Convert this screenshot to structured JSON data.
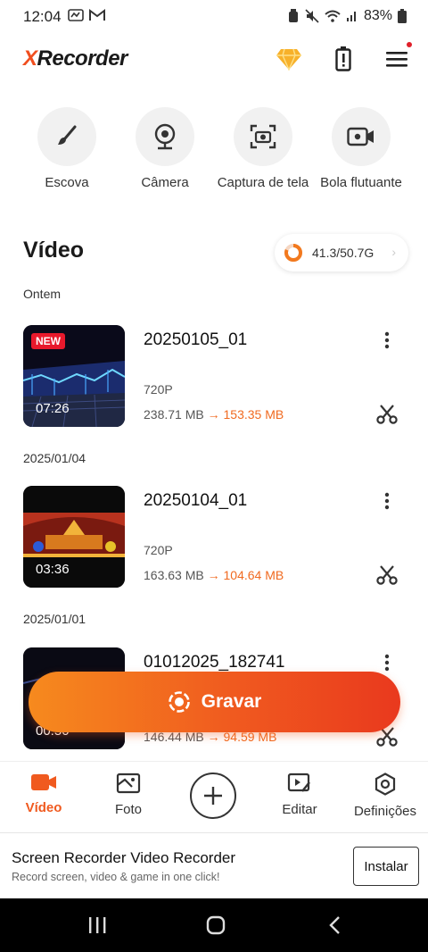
{
  "status_bar": {
    "time": "12:04",
    "battery": "83%"
  },
  "header": {
    "logo_x": "X",
    "logo_rest": "Recorder"
  },
  "tools": [
    {
      "label": "Escova",
      "icon": "brush-icon"
    },
    {
      "label": "Câmera",
      "icon": "webcam-icon"
    },
    {
      "label": "Captura de tela",
      "icon": "screenshot-icon"
    },
    {
      "label": "Bola flutuante",
      "icon": "video-camera-icon"
    }
  ],
  "section": {
    "title": "Vídeo",
    "storage": "41.3/50.7G",
    "storage_used_fraction": 0.81
  },
  "groups": [
    {
      "date": "Ontem",
      "item": {
        "name": "20250105_01",
        "badge": "NEW",
        "duration": "07:26",
        "resolution": "720P",
        "size_from": "238.71 MB",
        "arrow": "→",
        "size_to": "153.35 MB"
      }
    },
    {
      "date": "2025/01/04",
      "item": {
        "name": "20250104_01",
        "badge": "",
        "duration": "03:36",
        "resolution": "720P",
        "size_from": "163.63 MB",
        "arrow": "→",
        "size_to": "104.64 MB"
      }
    },
    {
      "date": "2025/01/01",
      "item": {
        "name": "01012025_182741",
        "badge": "",
        "duration": "00:50",
        "resolution": "",
        "size_from": "146.44 MB",
        "arrow": "→",
        "size_to": "94.59 MB"
      }
    }
  ],
  "record_button": {
    "label": "Gravar"
  },
  "nav": [
    {
      "label": "Vídeo",
      "active": true
    },
    {
      "label": "Foto"
    },
    {
      "label": "Editar"
    },
    {
      "label": "Definições"
    }
  ],
  "ad": {
    "title": "Screen Recorder Video Recorder",
    "subtitle": "Record screen, video & game in one click!",
    "button": "Instalar"
  },
  "colors": {
    "accent": "#f05a1f",
    "accent_light": "#f68a1e",
    "badge_red": "#e8192c"
  }
}
